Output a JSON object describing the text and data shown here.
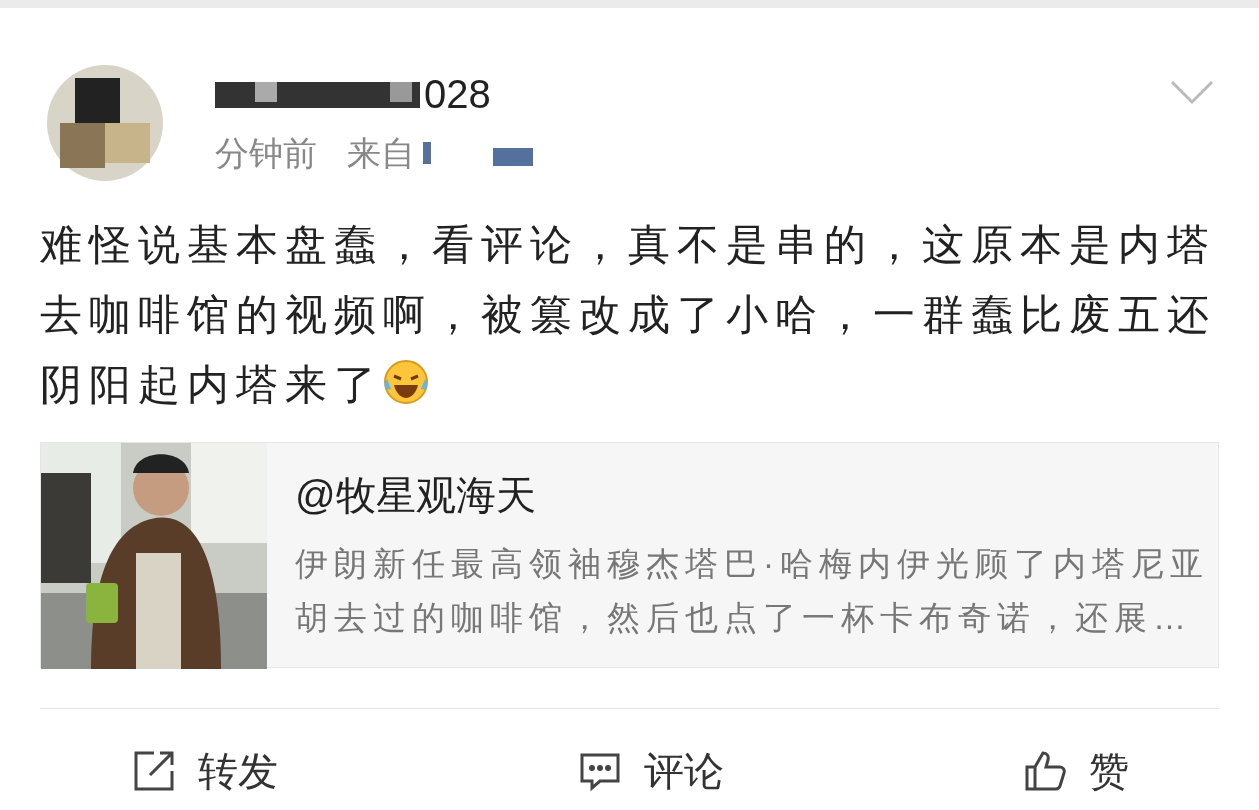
{
  "post": {
    "username_visible": "028",
    "time": "分钟前",
    "source_label": "来自",
    "text": "难怪说基本盘蠢，看评论，真不是串的，这原本是内塔去咖啡馆的视频啊，被篡改成了小哈，一群蠢比废五还阴阳起内塔来了"
  },
  "card": {
    "title": "@牧星观海天",
    "description": "伊朗新任最高领袖穆杰塔巴·哈梅内伊光顾了内塔尼亚胡去过的咖啡馆，然后也点了一杯卡布奇诺，还展…"
  },
  "actions": [
    {
      "kind": "repost",
      "label": "转发"
    },
    {
      "kind": "comment",
      "label": "评论"
    },
    {
      "kind": "like",
      "label": "赞"
    }
  ]
}
